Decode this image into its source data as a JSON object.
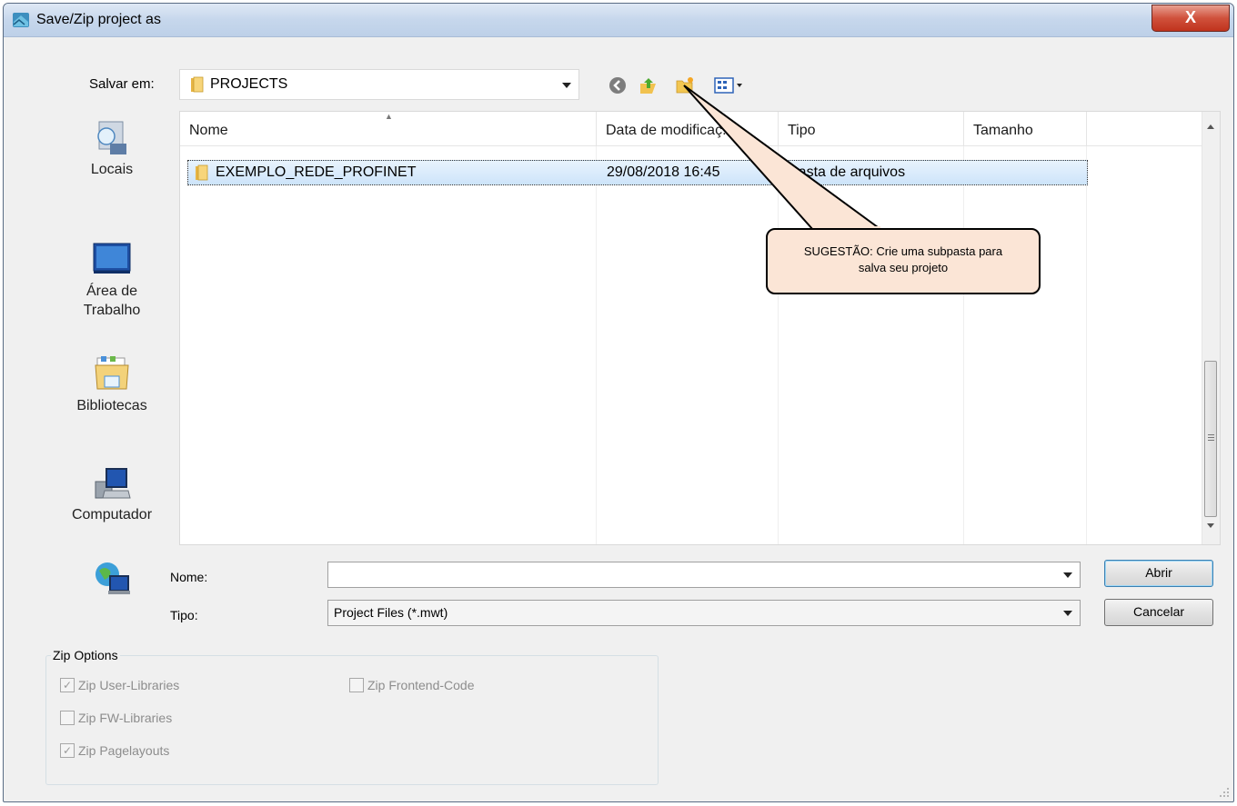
{
  "window": {
    "title": "Save/Zip project as",
    "close_label": "X"
  },
  "toolbar": {
    "save_in_label": "Salvar em:",
    "save_in_value": "PROJECTS",
    "icons": [
      "back-icon",
      "up-folder-icon",
      "new-folder-icon",
      "view-menu-icon"
    ]
  },
  "places": [
    {
      "label": "Locais",
      "icon": "recent-places-icon"
    },
    {
      "label": "Área de Trabalho",
      "icon": "desktop-icon"
    },
    {
      "label": "Bibliotecas",
      "icon": "libraries-icon"
    },
    {
      "label": "Computador",
      "icon": "computer-icon"
    },
    {
      "label": "",
      "icon": "network-icon"
    }
  ],
  "filelist": {
    "columns": [
      "Nome",
      "Data de modificaç...",
      "Tipo",
      "Tamanho"
    ],
    "rows": [
      {
        "name": "EXEMPLO_REDE_PROFINET",
        "date": "29/08/2018 16:45",
        "type": "Pasta de arquivos",
        "size": ""
      }
    ]
  },
  "callout": {
    "text": "SUGESTÃO: Crie uma subpasta para salva seu projeto"
  },
  "form": {
    "name_label": "Nome:",
    "name_value": "",
    "type_label": "Tipo:",
    "type_value": "Project Files (*.mwt)",
    "open_label": "Abrir",
    "cancel_label": "Cancelar"
  },
  "zip_options": {
    "legend": "Zip Options",
    "user_libraries": {
      "label": "Zip User-Libraries",
      "checked": true
    },
    "frontend_code": {
      "label": "Zip Frontend-Code",
      "checked": false
    },
    "fw_libraries": {
      "label": "Zip FW-Libraries",
      "checked": false
    },
    "pagelayouts": {
      "label": "Zip Pagelayouts",
      "checked": true
    }
  },
  "colors": {
    "callout_fill": "#fbe5d6",
    "selection": "#cde4fa",
    "close_button": "#c0331d"
  }
}
